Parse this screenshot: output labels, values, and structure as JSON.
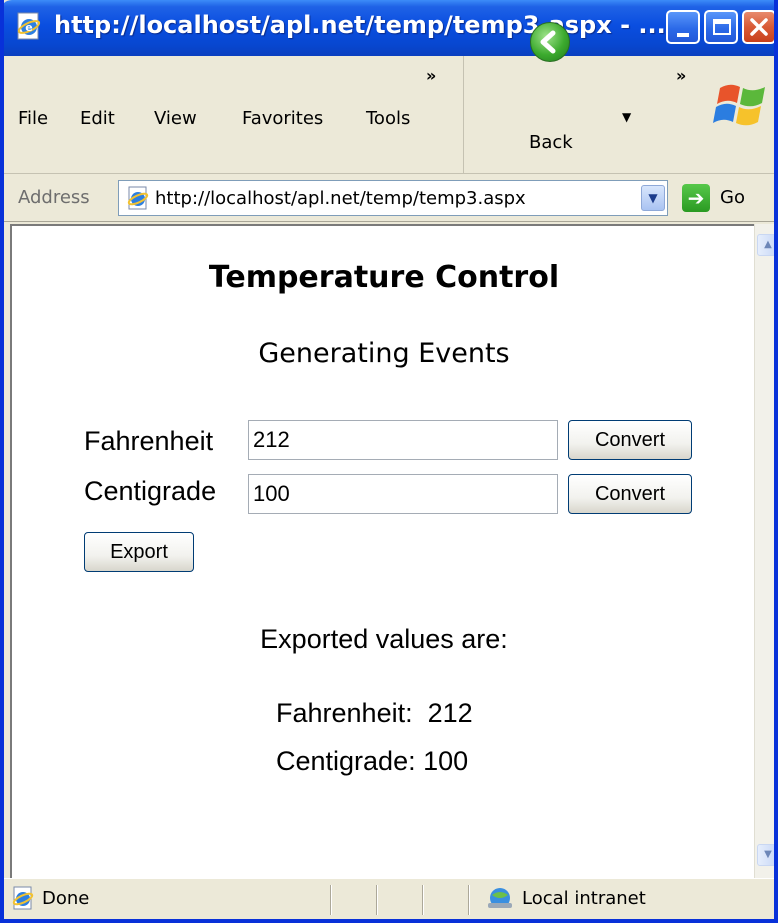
{
  "window": {
    "title": "http://localhost/apl.net/temp/temp3.aspx - ..."
  },
  "menubar": {
    "file": "File",
    "edit": "Edit",
    "view": "View",
    "favorites": "Favorites",
    "tools": "Tools",
    "more": "»"
  },
  "toolbar": {
    "back_label": "Back",
    "more": "»"
  },
  "address": {
    "label": "Address",
    "url": "http://localhost/apl.net/temp/temp3.aspx",
    "go_label": "Go"
  },
  "page": {
    "title": "Temperature Control",
    "subtitle": "Generating Events",
    "fahrenheit_label": "Fahrenheit",
    "fahrenheit_value": "212",
    "centigrade_label": "Centigrade",
    "centigrade_value": "100",
    "convert_label": "Convert",
    "export_label": "Export",
    "exported_heading": "Exported values are:",
    "exported_fahrenheit": "Fahrenheit:  212",
    "exported_centigrade": "Centigrade: 100"
  },
  "statusbar": {
    "status": "Done",
    "zone": "Local intranet"
  },
  "colors": {
    "titlebar": "#0a4ee0",
    "window_frame": "#0831d9",
    "chrome": "#ece9d8",
    "button_border": "#003c74"
  },
  "icons": {
    "title": "ie-page-icon",
    "back": "back-arrow-icon",
    "go": "go-arrow-icon",
    "logo": "windows-logo-icon",
    "status": "ie-page-icon",
    "zone": "intranet-icon"
  }
}
